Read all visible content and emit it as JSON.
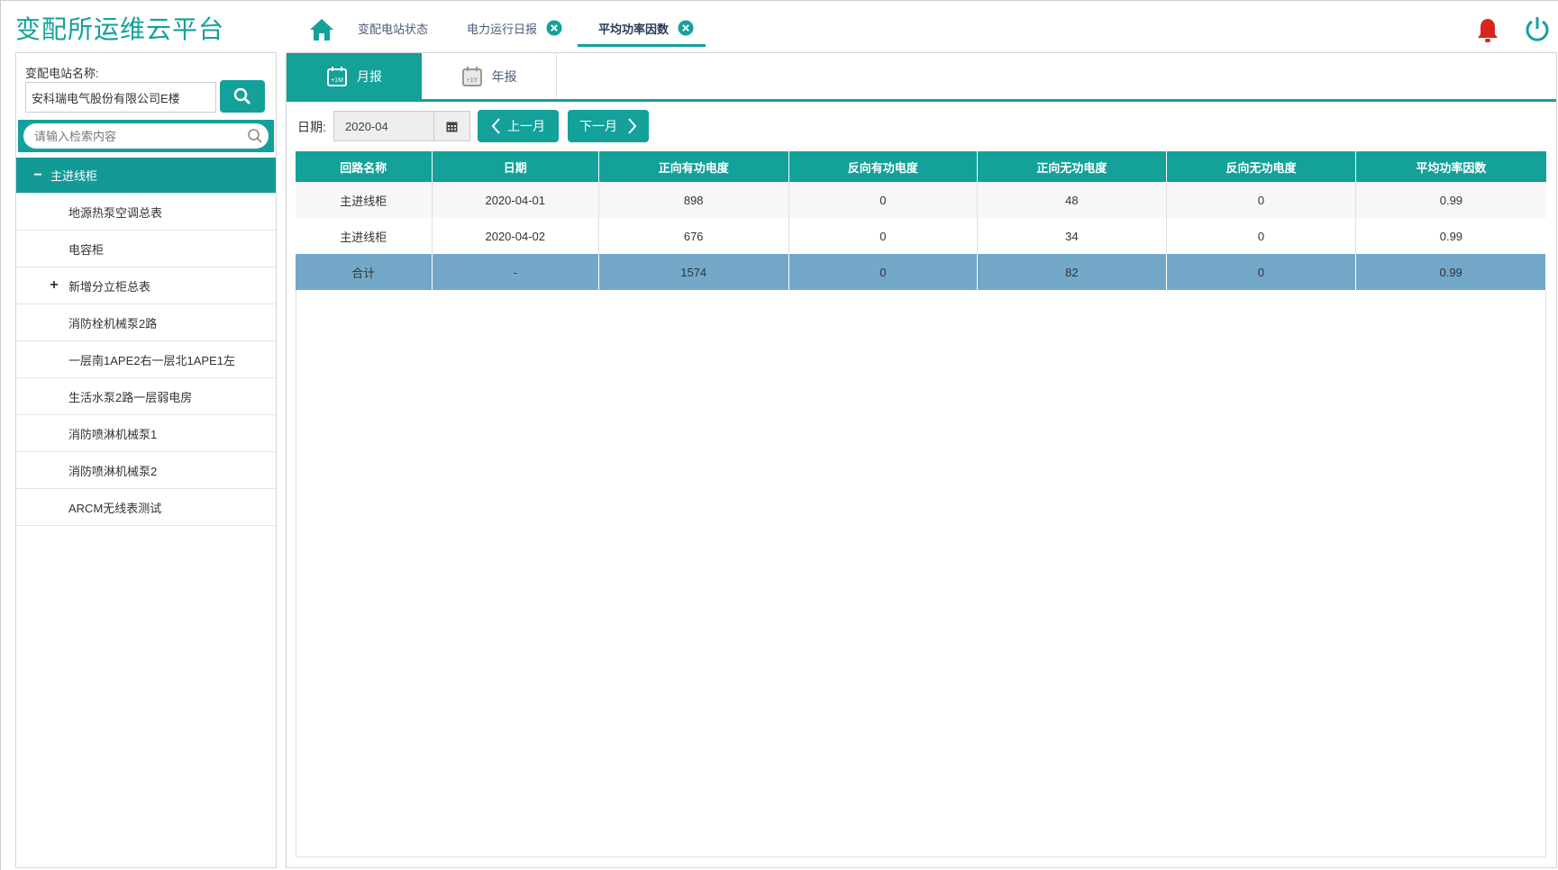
{
  "app": {
    "title": "变配所运维云平台"
  },
  "tabs": [
    {
      "label": "变配电站状态",
      "closable": false
    },
    {
      "label": "电力运行日报",
      "closable": true
    },
    {
      "label": "平均功率因数",
      "closable": true,
      "active": true
    }
  ],
  "icons": {
    "home": "home-icon",
    "close": "close-circle-icon",
    "bell": "bell-icon",
    "power": "power-icon",
    "search": "search-icon",
    "calendar": "calendar-icon"
  },
  "colors": {
    "accent": "#13a19a",
    "total_row": "#73a8c9",
    "bell": "#d9261c"
  },
  "sidebar": {
    "station_label": "变配电站名称:",
    "station_value": "安科瑞电气股份有限公司E楼",
    "filter_placeholder": "请输入检索内容",
    "tree": [
      {
        "label": "主进线柜",
        "expander": "−",
        "root": true
      },
      {
        "label": "地源热泵空调总表"
      },
      {
        "label": "电容柜"
      },
      {
        "label": "新增分立柜总表",
        "expander": "+"
      },
      {
        "label": "消防栓机械泵2路"
      },
      {
        "label": "一层南1APE2右一层北1APE1左"
      },
      {
        "label": "生活水泵2路一层弱电房"
      },
      {
        "label": "消防喷淋机械泵1"
      },
      {
        "label": "消防喷淋机械泵2"
      },
      {
        "label": "ARCM无线表测试"
      }
    ]
  },
  "report_tabs": {
    "month": "月报",
    "year": "年报",
    "month_icon_text": "+1M",
    "year_icon_text": "+1Y"
  },
  "filter": {
    "date_label": "日期:",
    "date_value": "2020-04",
    "prev_label": "上一月",
    "next_label": "下一月"
  },
  "table": {
    "headers": [
      "回路名称",
      "日期",
      "正向有功电度",
      "反向有功电度",
      "正向无功电度",
      "反向无功电度",
      "平均功率因数"
    ],
    "rows": [
      [
        "主进线柜",
        "2020-04-01",
        "898",
        "0",
        "48",
        "0",
        "0.99"
      ],
      [
        "主进线柜",
        "2020-04-02",
        "676",
        "0",
        "34",
        "0",
        "0.99"
      ]
    ],
    "total": [
      "合计",
      "-",
      "1574",
      "0",
      "82",
      "0",
      "0.99"
    ]
  }
}
